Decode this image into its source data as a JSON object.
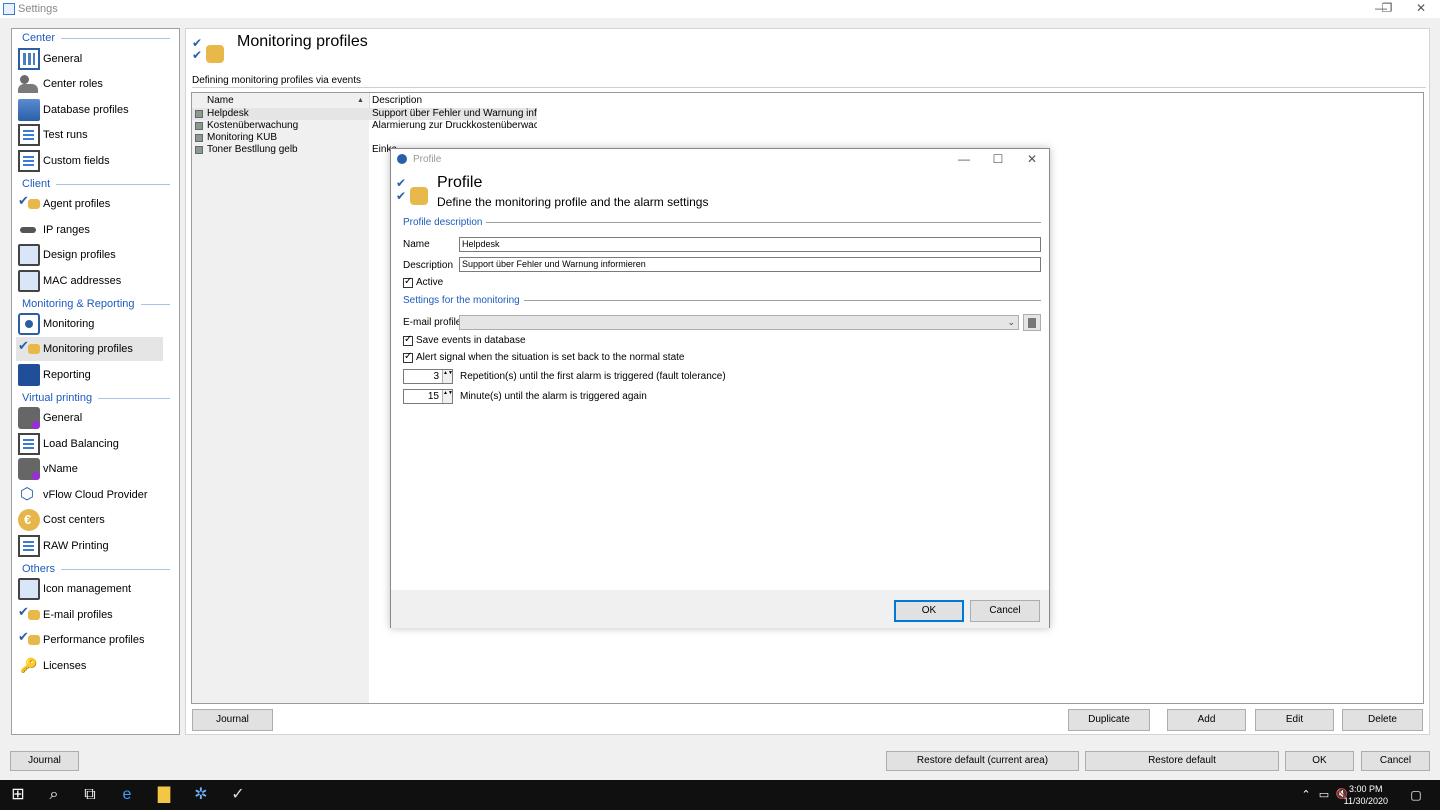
{
  "window": {
    "title": "Settings",
    "minimize": "—",
    "restore": "❐",
    "close": "✕"
  },
  "nav": {
    "sections": [
      {
        "label": "Center"
      },
      {
        "label": "Client"
      },
      {
        "label": "Monitoring & Reporting"
      },
      {
        "label": "Virtual printing"
      },
      {
        "label": "Others"
      }
    ],
    "items": [
      {
        "label": "General",
        "icon": "grid-icon"
      },
      {
        "label": "Center roles",
        "icon": "people-icon"
      },
      {
        "label": "Database profiles",
        "icon": "database-icon"
      },
      {
        "label": "Test runs",
        "icon": "document-icon"
      },
      {
        "label": "Custom fields",
        "icon": "document-icon"
      },
      {
        "label": "Agent profiles",
        "icon": "checklist-icon"
      },
      {
        "label": "IP ranges",
        "icon": "plug-icon"
      },
      {
        "label": "Design profiles",
        "icon": "monitor-icon"
      },
      {
        "label": "MAC addresses",
        "icon": "monitor-icon"
      },
      {
        "label": "Monitoring",
        "icon": "target-icon"
      },
      {
        "label": "Monitoring profiles",
        "icon": "checklist-icon"
      },
      {
        "label": "Reporting",
        "icon": "book-icon"
      },
      {
        "label": "General",
        "icon": "printer-icon"
      },
      {
        "label": "Load Balancing",
        "icon": "document-icon"
      },
      {
        "label": "vName",
        "icon": "printer-icon"
      },
      {
        "label": "vFlow Cloud Provider",
        "icon": "nodes-icon"
      },
      {
        "label": "Cost centers",
        "icon": "euro-icon"
      },
      {
        "label": "RAW Printing",
        "icon": "document-icon"
      },
      {
        "label": "Icon management",
        "icon": "monitor-icon"
      },
      {
        "label": "E-mail profiles",
        "icon": "checklist-icon"
      },
      {
        "label": "Performance profiles",
        "icon": "checklist-icon"
      },
      {
        "label": "Licenses",
        "icon": "key-icon"
      }
    ]
  },
  "main": {
    "title": "Monitoring profiles",
    "section": "Defining monitoring profiles via events",
    "columns": {
      "name": "Name",
      "description": "Description"
    },
    "sort_glyph": "▲",
    "rows": [
      {
        "name": "Helpdesk",
        "description": "Support über Fehler und Warnung inf..."
      },
      {
        "name": "Kostenüberwachung",
        "description": "Alarmierung  zur  Druckkostenüberwac..."
      },
      {
        "name": "Monitoring KUB",
        "description": ""
      },
      {
        "name": "Toner Bestllung gelb",
        "description": "Einka"
      }
    ],
    "buttons": {
      "journal": "Journal",
      "duplicate": "Duplicate",
      "add": "Add",
      "edit": "Edit",
      "delete": "Delete"
    }
  },
  "dialog": {
    "window_title": "Profile",
    "title": "Profile",
    "subtitle": "Define the monitoring profile and the alarm settings",
    "group_description": "Profile description",
    "name_label": "Name",
    "name_value": "Helpdesk",
    "description_label": "Description",
    "description_value": "Support über Fehler und Warnung informieren",
    "active_label": "Active",
    "group_monitoring": "Settings for the monitoring",
    "email_profile_label": "E-mail profile",
    "email_profile_value": "",
    "combo_arrow": "⌄",
    "save_events_label": "Save events in database",
    "alert_signal_label": "Alert signal when the situation is set back to the normal state",
    "repetitions_value": "3",
    "repetitions_label": "Repetition(s) until the first alarm is triggered (fault tolerance)",
    "minutes_value": "15",
    "minutes_label": "Minute(s) until the alarm is triggered again",
    "spin_arrows": "▲▼",
    "ok": "OK",
    "cancel": "Cancel",
    "minimize": "—",
    "maximize": "☐",
    "close": "✕"
  },
  "footer": {
    "journal": "Journal",
    "restore_current": "Restore default (current area)",
    "restore_default": "Restore default",
    "ok": "OK",
    "cancel": "Cancel"
  },
  "taskbar": {
    "time": "3:00 PM",
    "date": "11/30/2020",
    "icons": [
      "windows-start-icon",
      "search-icon",
      "task-view-icon",
      "edge-browser-icon",
      "file-explorer-icon",
      "app-icon",
      "settings-app-icon"
    ],
    "tray_chevron": "⌃",
    "tray_network": "▭",
    "tray_volume": "🔇",
    "notifications": "▢"
  }
}
